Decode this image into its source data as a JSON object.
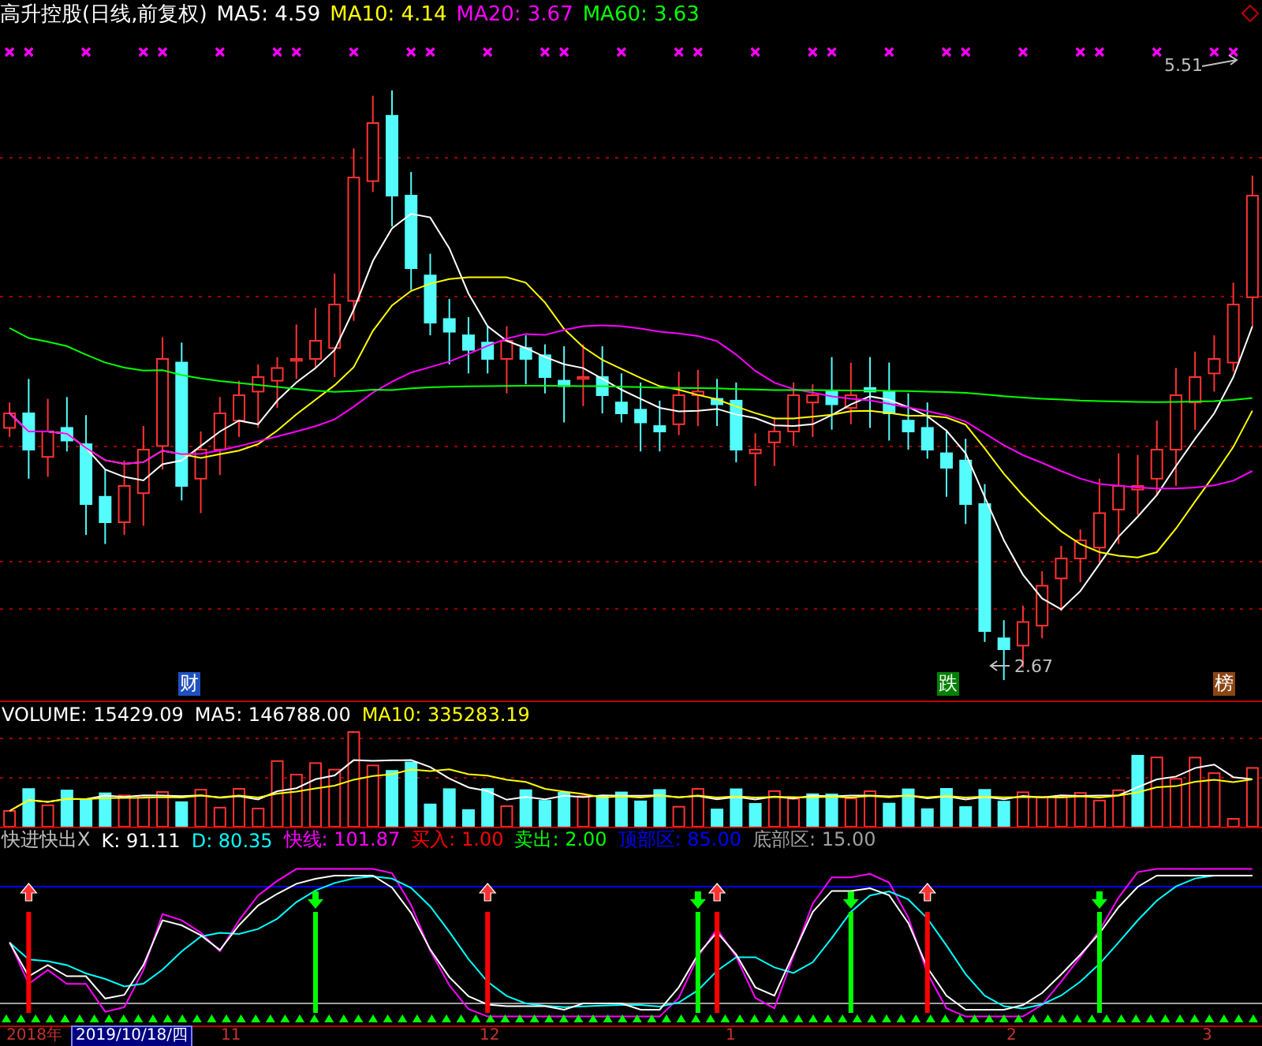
{
  "header": {
    "title": "高升控股(日线,前复权)",
    "legend": [
      {
        "text": "MA5: 4.59",
        "color": "#ffffff"
      },
      {
        "text": "MA10: 4.14",
        "color": "#ffff00"
      },
      {
        "text": "MA20: 3.67",
        "color": "#ff00ff"
      },
      {
        "text": "MA60: 3.63",
        "color": "#00ff00"
      }
    ]
  },
  "price_panel": {
    "high_label": "5.51",
    "low_label": "2.67",
    "badges": [
      {
        "text": "财",
        "color": "#2050c0"
      },
      {
        "text": "跌",
        "color": "#008000"
      },
      {
        "text": "榜",
        "color": "#8b4513"
      }
    ]
  },
  "volume_panel": {
    "legend": [
      {
        "text": "VOLUME: 15429.09",
        "color": "#ffffff"
      },
      {
        "text": "MA5: 146788.00",
        "color": "#ffffff"
      },
      {
        "text": "MA10: 335283.19",
        "color": "#ffff00"
      }
    ]
  },
  "indicator_panel": {
    "legend": [
      {
        "text": "快进快出X",
        "color": "#c0c0c0"
      },
      {
        "text": "K: 91.11",
        "color": "#ffffff"
      },
      {
        "text": "D: 80.35",
        "color": "#00ffff"
      },
      {
        "text": "快线: 101.87",
        "color": "#ff00ff"
      },
      {
        "text": "买入: 1.00",
        "color": "#ff0000"
      },
      {
        "text": "卖出: 2.00",
        "color": "#00ff00"
      },
      {
        "text": "顶部区: 85.00",
        "color": "#0000ff"
      },
      {
        "text": "底部区: 15.00",
        "color": "#a0a0a0"
      }
    ]
  },
  "time_axis": {
    "labels": [
      {
        "text": "2018年",
        "selected": false
      },
      {
        "text": "2019/10/18/四",
        "selected": true
      },
      {
        "text": "11",
        "selected": false
      },
      {
        "text": "12",
        "selected": false
      },
      {
        "text": "1",
        "selected": false
      },
      {
        "text": "2",
        "selected": false
      },
      {
        "text": "3",
        "selected": false
      }
    ]
  }
}
